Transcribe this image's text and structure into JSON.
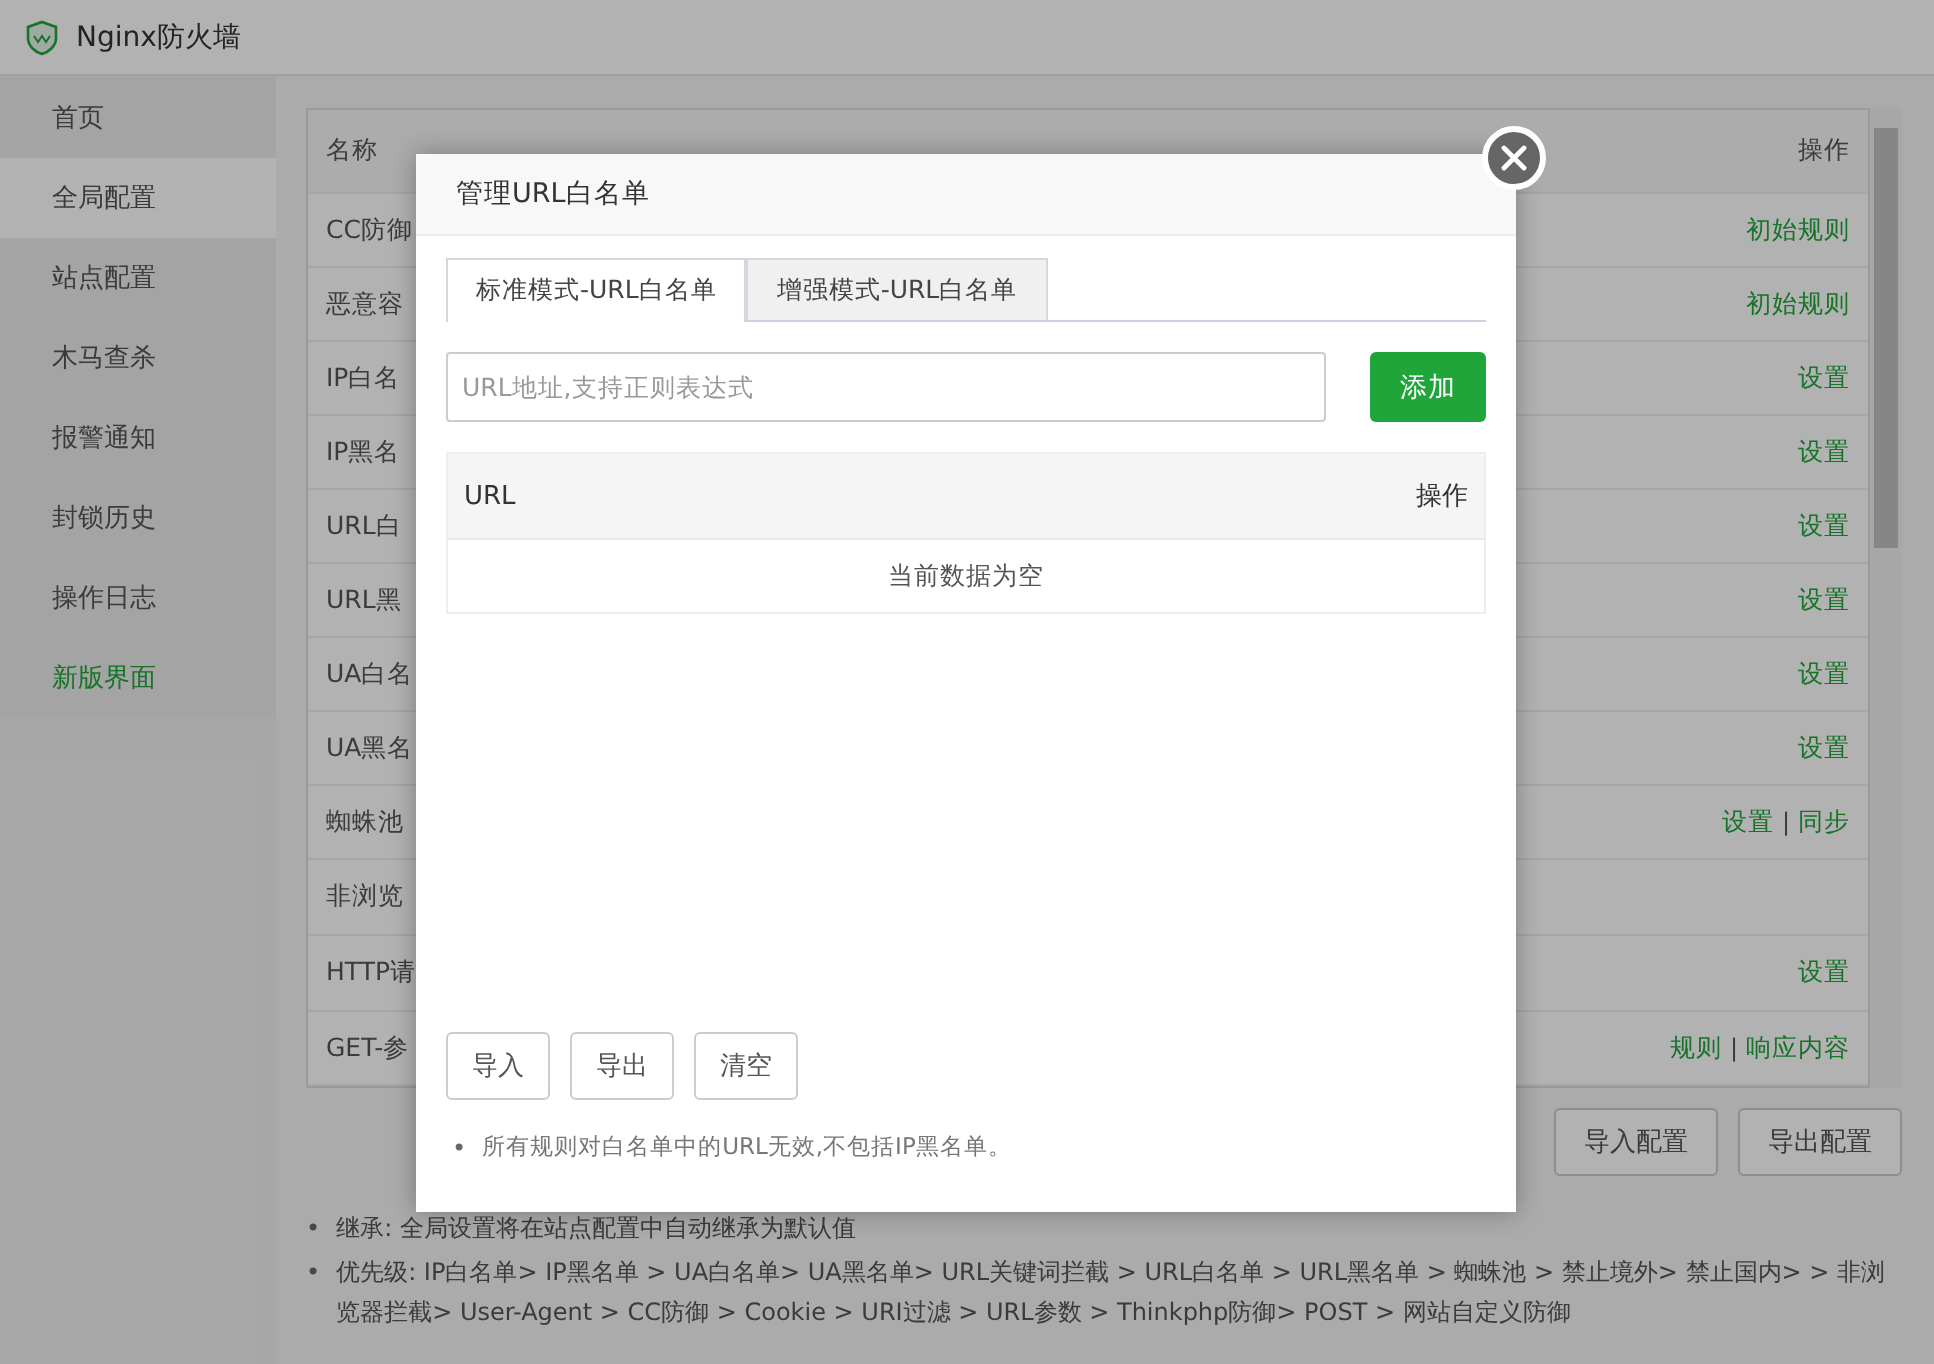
{
  "app": {
    "title": "Nginx防火墙"
  },
  "sidebar": {
    "items": [
      {
        "label": "首页",
        "selected": false,
        "kind": "page"
      },
      {
        "label": "全局配置",
        "selected": true,
        "kind": "page"
      },
      {
        "label": "站点配置",
        "selected": false,
        "kind": "page"
      },
      {
        "label": "木马查杀",
        "selected": false,
        "kind": "page"
      },
      {
        "label": "报警通知",
        "selected": false,
        "kind": "page"
      },
      {
        "label": "封锁历史",
        "selected": false,
        "kind": "page"
      },
      {
        "label": "操作日志",
        "selected": false,
        "kind": "page"
      },
      {
        "label": "新版界面",
        "selected": false,
        "kind": "link"
      }
    ]
  },
  "table": {
    "columns": [
      "名称",
      "操作"
    ],
    "rows": [
      {
        "name": "CC防御",
        "actions": [
          "初始规则"
        ]
      },
      {
        "name": "恶意容",
        "actions": [
          "初始规则"
        ]
      },
      {
        "name": "IP白名",
        "actions": [
          "设置"
        ]
      },
      {
        "name": "IP黑名",
        "actions": [
          "设置"
        ]
      },
      {
        "name": "URL白",
        "actions": [
          "设置"
        ]
      },
      {
        "name": "URL黑",
        "actions": [
          "设置"
        ]
      },
      {
        "name": "UA白名",
        "actions": [
          "设置"
        ]
      },
      {
        "name": "UA黑名",
        "actions": [
          "设置"
        ]
      },
      {
        "name": "蜘蛛池",
        "actions": [
          "设置",
          "同步"
        ]
      },
      {
        "name": "非浏览",
        "actions": []
      },
      {
        "name": "HTTP请",
        "actions": [
          "设置"
        ]
      },
      {
        "name": "GET-参",
        "actions": [
          "规则",
          "响应内容"
        ]
      }
    ]
  },
  "action_separator": "|",
  "bullet": "•",
  "footer_buttons": [
    "导入配置",
    "导出配置"
  ],
  "notes": [
    "继承: 全局设置将在站点配置中自动继承为默认值",
    "优先级: IP白名单> IP黑名单 > UA白名单> UA黑名单> URL关键词拦截 > URL白名单 > URL黑名单 > 蜘蛛池 > 禁止境外> 禁止国内> > 非浏览器拦截> User-Agent > CC防御 > Cookie > URI过滤 > URL参数 > Thinkphp防御> POST > 网站自定义防御"
  ],
  "dialog": {
    "title": "管理URL白名单",
    "tabs": [
      {
        "label": "标准模式-URL白名单",
        "selected": true
      },
      {
        "label": "增强模式-URL白名单",
        "selected": false
      }
    ],
    "input": {
      "placeholder": "URL地址,支持正则表达式"
    },
    "add_button": "添加",
    "table": {
      "columns": [
        "URL",
        "操作"
      ],
      "empty_text": "当前数据为空"
    },
    "buttons": [
      "导入",
      "导出",
      "清空"
    ],
    "note": "所有规则对白名单中的URL无效,不包括IP黑名单。"
  }
}
